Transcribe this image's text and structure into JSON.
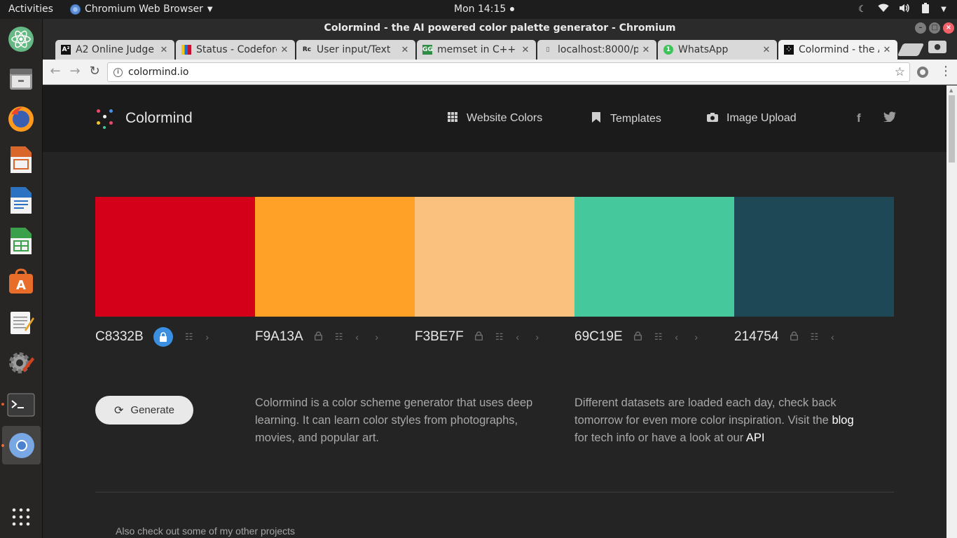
{
  "topbar": {
    "activities": "Activities",
    "app_name": "Chromium Web Browser",
    "clock": "Mon 14:15"
  },
  "dock": {
    "apps": [
      "atom",
      "files",
      "firefox",
      "impress",
      "writer",
      "calc",
      "software-center",
      "text-editor",
      "system-settings",
      "terminal",
      "chromium",
      "show-apps"
    ]
  },
  "window": {
    "title": "Colormind - the AI powered color palette generator - Chromium"
  },
  "tabs": [
    {
      "title": "A2 Online Judge",
      "favicon": "A²"
    },
    {
      "title": "Status - Codeforces",
      "favicon": "▮"
    },
    {
      "title": "User input/Text",
      "favicon": "Rc"
    },
    {
      "title": "memset in C++ -",
      "favicon": "GG"
    },
    {
      "title": "localhost:8000/p",
      "favicon": "▯"
    },
    {
      "title": "WhatsApp",
      "favicon": "1"
    },
    {
      "title": "Colormind - the A",
      "favicon": "⁘"
    }
  ],
  "omnibox": {
    "url": "colormind.io"
  },
  "site": {
    "brand": "Colormind",
    "nav": [
      {
        "label": "Website Colors",
        "icon": "grid-icon"
      },
      {
        "label": "Templates",
        "icon": "bookmark-icon"
      },
      {
        "label": "Image Upload",
        "icon": "camera-icon"
      }
    ],
    "social": {
      "facebook": "f",
      "twitter": "🐦"
    },
    "palette": [
      {
        "hex": "C8332B",
        "color": "#d4001a",
        "locked": true
      },
      {
        "hex": "F9A13A",
        "color": "#ffa126",
        "locked": false
      },
      {
        "hex": "F3BE7F",
        "color": "#f9c07e",
        "locked": false
      },
      {
        "hex": "69C19E",
        "color": "#45c99c",
        "locked": false
      },
      {
        "hex": "214754",
        "color": "#1f4857",
        "locked": false
      }
    ],
    "generate_label": "Generate",
    "blurb_left": "Colormind is a color scheme generator that uses deep learning. It can learn color styles from photographs, movies, and popular art.",
    "blurb_right_part1": "Different datasets are loaded each day, check back tomorrow for even more color inspiration. Visit the ",
    "blurb_right_link1": "blog",
    "blurb_right_part2": " for tech info or have a look at our ",
    "blurb_right_link2": "API",
    "also_text": "Also check out some of my other projects"
  }
}
